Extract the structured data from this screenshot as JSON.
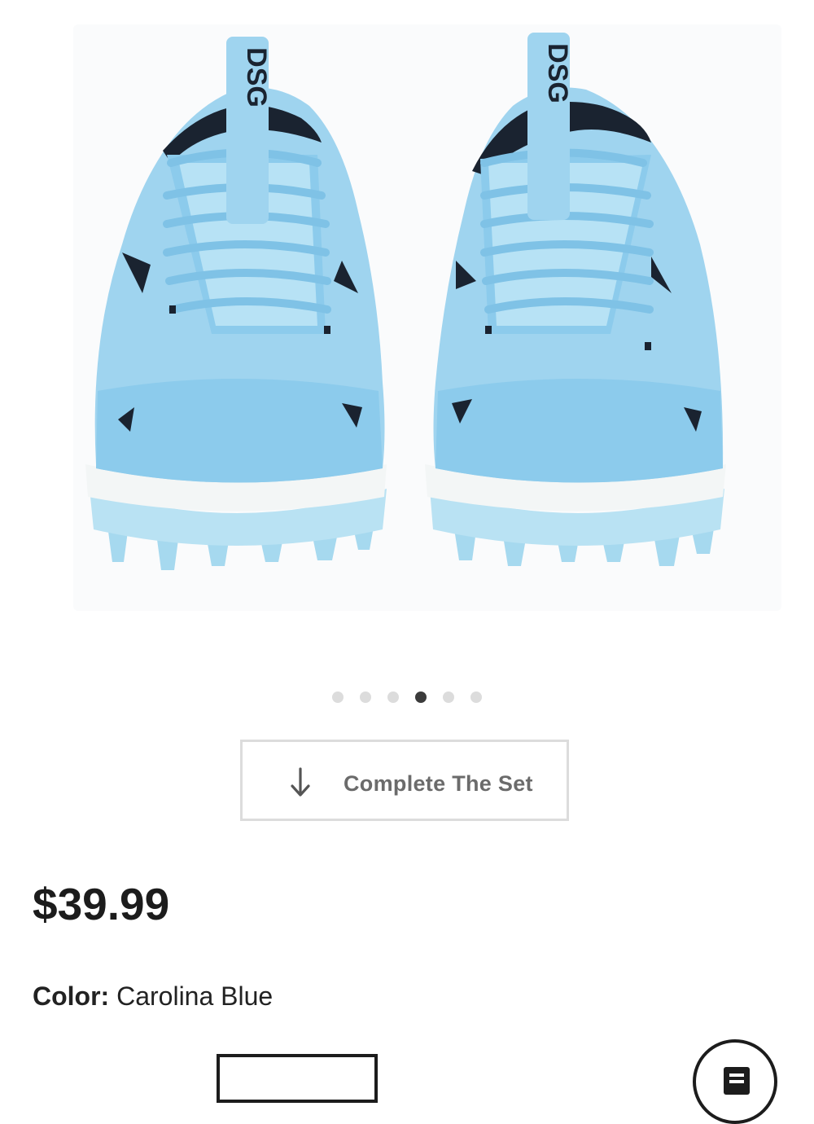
{
  "product": {
    "price": "$39.99",
    "color_label": "Color:",
    "color_value": "Carolina Blue",
    "brand_tag": "DSG"
  },
  "gallery": {
    "image_count": 6,
    "active_index": 3
  },
  "complete_the_set": {
    "label": "Complete The Set",
    "icon": "arrow-down-icon"
  },
  "colors": {
    "shoe_main": "#9fd4ef",
    "shoe_shade": "#7fc2e6",
    "shoe_accent": "#1a2330",
    "sole": "#f2f4f4",
    "cleat": "#a6d9ef",
    "dot_active": "#3b3b3b",
    "dot_inactive": "#dcdcdc",
    "button_border": "#dcdcdc",
    "button_text": "#6b6b6b"
  }
}
